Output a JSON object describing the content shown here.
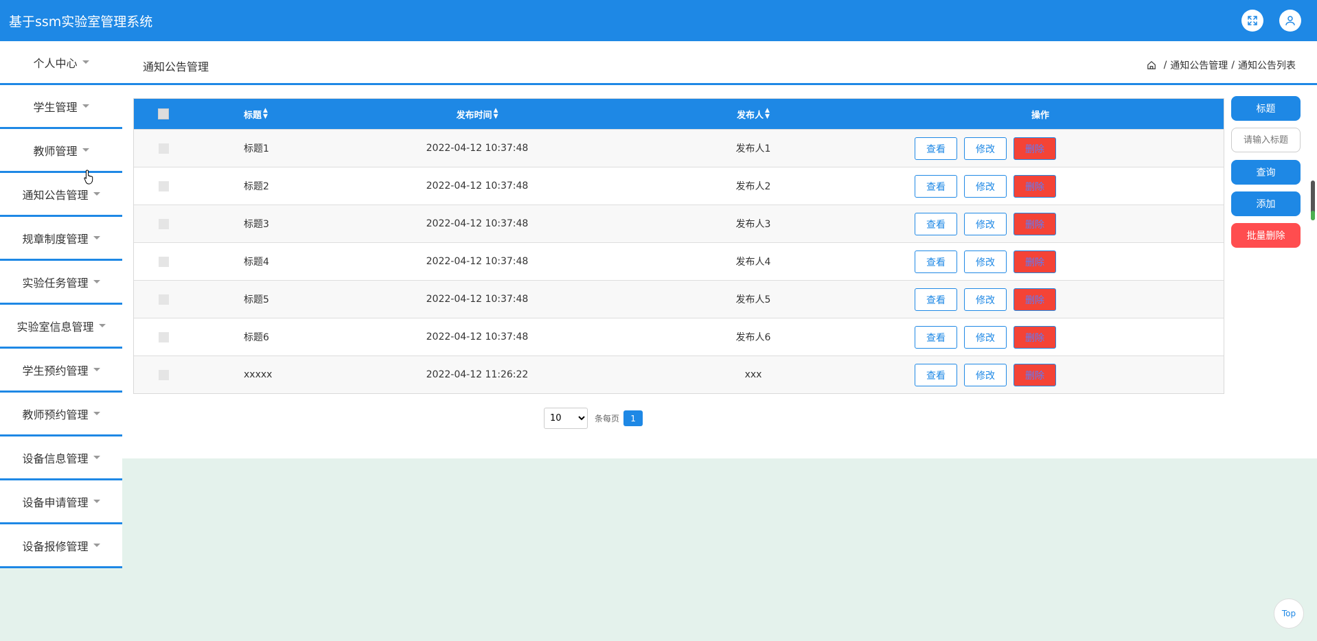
{
  "app": {
    "title": "基于ssm实验室管理系统"
  },
  "header_icons": [
    {
      "icon": "fullscreen-icon"
    },
    {
      "icon": "user-icon"
    }
  ],
  "sidebar": {
    "items": [
      {
        "label": "个人中心"
      },
      {
        "label": "学生管理"
      },
      {
        "label": "教师管理"
      },
      {
        "label": "通知公告管理"
      },
      {
        "label": "规章制度管理"
      },
      {
        "label": "实验任务管理"
      },
      {
        "label": "实验室信息管理"
      },
      {
        "label": "学生预约管理"
      },
      {
        "label": "教师预约管理"
      },
      {
        "label": "设备信息管理"
      },
      {
        "label": "设备申请管理"
      },
      {
        "label": "设备报修管理"
      }
    ]
  },
  "page": {
    "title": "通知公告管理",
    "breadcrumb": [
      "通知公告管理",
      "通知公告列表"
    ],
    "breadcrumb_sep": "/"
  },
  "table": {
    "columns": {
      "title": "标题",
      "time": "发布时间",
      "publisher": "发布人",
      "ops": "操作"
    },
    "rows": [
      {
        "title": "标题1",
        "time": "2022-04-12 10:37:48",
        "publisher": "发布人1"
      },
      {
        "title": "标题2",
        "time": "2022-04-12 10:37:48",
        "publisher": "发布人2"
      },
      {
        "title": "标题3",
        "time": "2022-04-12 10:37:48",
        "publisher": "发布人3"
      },
      {
        "title": "标题4",
        "time": "2022-04-12 10:37:48",
        "publisher": "发布人4"
      },
      {
        "title": "标题5",
        "time": "2022-04-12 10:37:48",
        "publisher": "发布人5"
      },
      {
        "title": "标题6",
        "time": "2022-04-12 10:37:48",
        "publisher": "发布人6"
      },
      {
        "title": "xxxxx",
        "time": "2022-04-12 11:26:22",
        "publisher": "xxx"
      }
    ],
    "ops": {
      "view": "查看",
      "edit": "修改",
      "delete": "删除"
    }
  },
  "pager": {
    "page_size": "10",
    "per_page_label": "条每页",
    "current_page": "1"
  },
  "search": {
    "label": "标题",
    "placeholder": "请输入标题",
    "query": "查询",
    "add": "添加",
    "batch_delete": "批量删除"
  },
  "top_button": "Top",
  "colors": {
    "primary": "#1e88e5",
    "danger": "#f44336",
    "background": "#e4f2ec"
  }
}
